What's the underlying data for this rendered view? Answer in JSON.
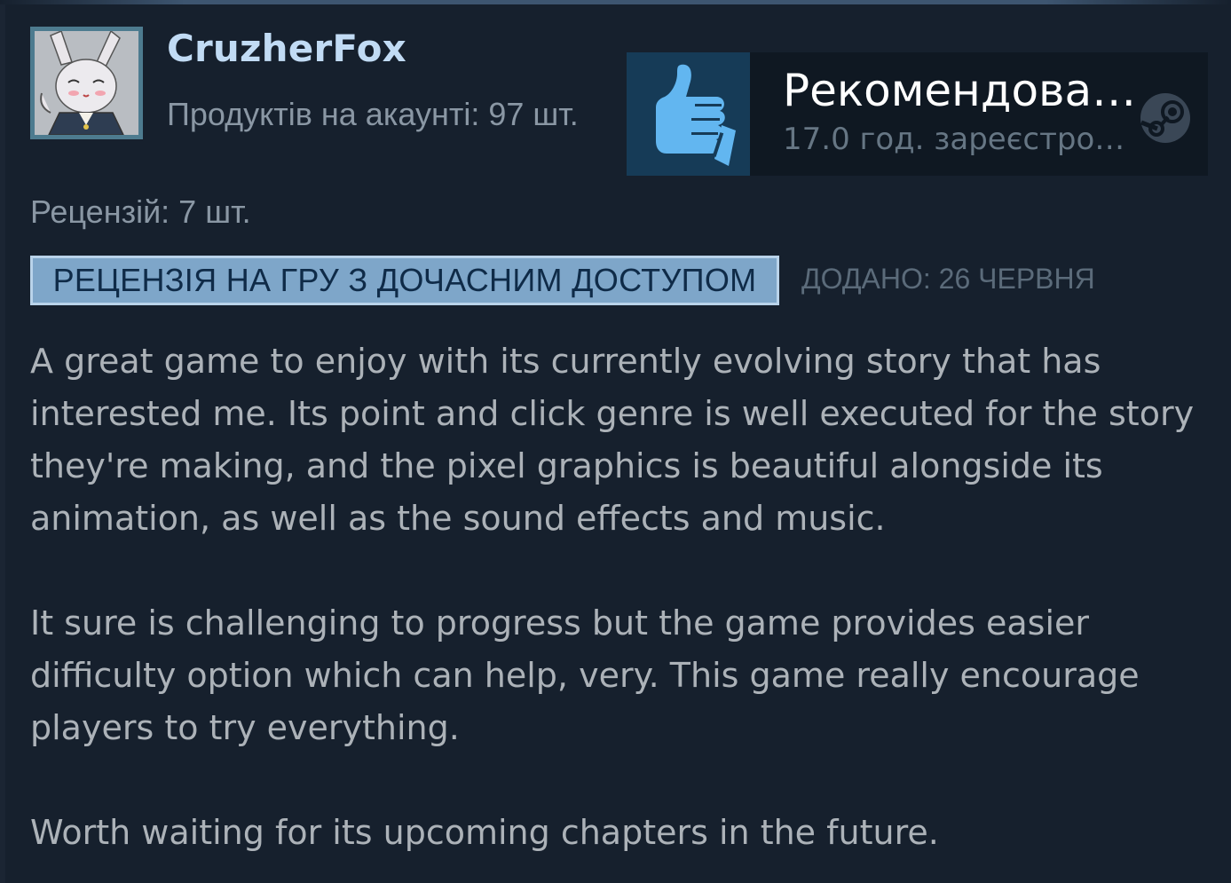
{
  "reviewer": {
    "username": "CruzherFox",
    "products_owned": "Продуктів на акаунті: 97 шт.",
    "reviews_count": "Рецензій: 7 шт."
  },
  "recommendation": {
    "label": "Рекомендова…",
    "hours": "17.0 год. зареєстро…",
    "icon": "thumbs-up-icon",
    "platform_icon": "steam-icon"
  },
  "badge": {
    "label": "РЕЦЕНЗІЯ НА ГРУ З ДОЧАСНИМ ДОСТУПОМ"
  },
  "posted": "ДОДАНО: 26 ЧЕРВНЯ",
  "review": {
    "paragraphs": [
      "A great game to enjoy with its currently evolving story that has interested me. Its point and click genre is well executed for the story they're making, and the pixel graphics is beautiful alongside its animation, as well as the sound effects and music.",
      "It sure is challenging to progress but the game provides easier difficulty option which can help, very. This game really encourage players to try everything.",
      "Worth waiting for its upcoming chapters in the future."
    ]
  },
  "colors": {
    "background": "#16202d",
    "username": "#c1dbf4",
    "badge_bg": "#7ea6c9",
    "thumb": "#62b6f0"
  }
}
